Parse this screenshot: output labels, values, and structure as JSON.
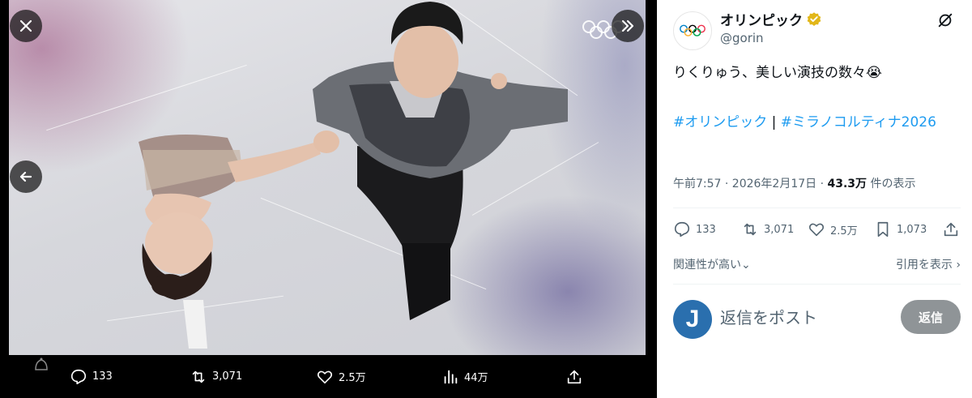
{
  "viewer": {
    "close_icon": "close-icon",
    "collapse_icon": "double-chevron-right-icon",
    "prev_icon": "arrow-left-icon",
    "rings_icon": "olympic-rings-icon",
    "actions": {
      "replies": "133",
      "reposts": "3,071",
      "likes": "2.5万",
      "views": "44万"
    }
  },
  "tweet": {
    "author_name": "オリンピック",
    "author_handle": "@gorin",
    "text": "りくりゅう、美しい演技の数々😭",
    "hashtag_1": "#オリンピック",
    "separator": "|",
    "hashtag_2": "#ミラノコルティナ2026",
    "time": "午前7:57 · 2026年2月17日 · ",
    "views_count": "43.3万",
    "views_label": " 件の表示",
    "actions": {
      "replies": "133",
      "reposts": "3,071",
      "likes": "2.5万",
      "bookmarks": "1,073"
    },
    "sort_label": "関連性が高い",
    "quotes_label": "引用を表示",
    "reply_avatar_letter": "J",
    "reply_placeholder": "返信をポスト",
    "reply_button": "返信"
  },
  "colors": {
    "accent": "#1d9bf0",
    "verified": "#e2b719",
    "reply_button_bg": "#8f9497"
  }
}
